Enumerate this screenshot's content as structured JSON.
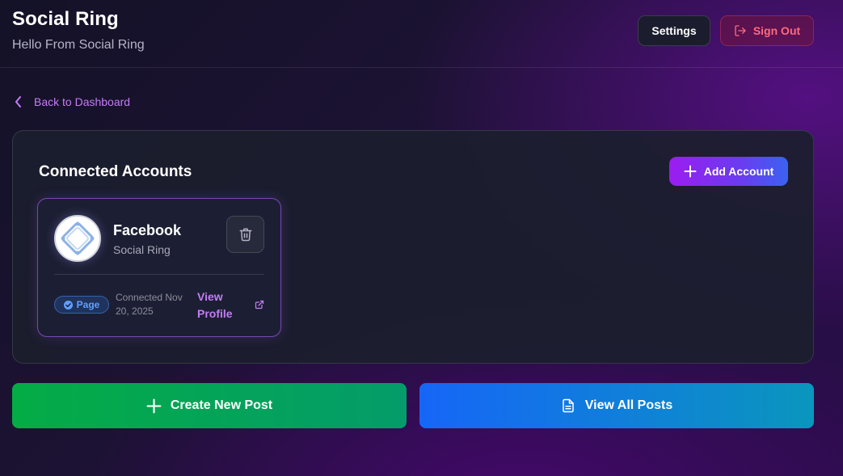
{
  "header": {
    "title": "Social Ring",
    "subtitle": "Hello From Social Ring",
    "settings_label": "Settings",
    "signout_label": "Sign Out"
  },
  "nav": {
    "back_label": "Back to Dashboard"
  },
  "accounts_section": {
    "title": "Connected Accounts",
    "add_label": "Add Account",
    "accounts": [
      {
        "platform": "Facebook",
        "name": "Social Ring",
        "badge": "Page",
        "connected": "Connected Nov 20, 2025",
        "view_label": "View Profile",
        "avatar_icon": "social-ring-logo-icon"
      }
    ]
  },
  "actions": {
    "create_label": "Create New Post",
    "view_all_label": "View All Posts"
  },
  "colors": {
    "accent_purple": "#c47cf5",
    "signout_red": "#ff6a7e",
    "create_green": "#04ac45",
    "view_blue": "#1666f7",
    "badge_blue": "#5ea0ff"
  }
}
